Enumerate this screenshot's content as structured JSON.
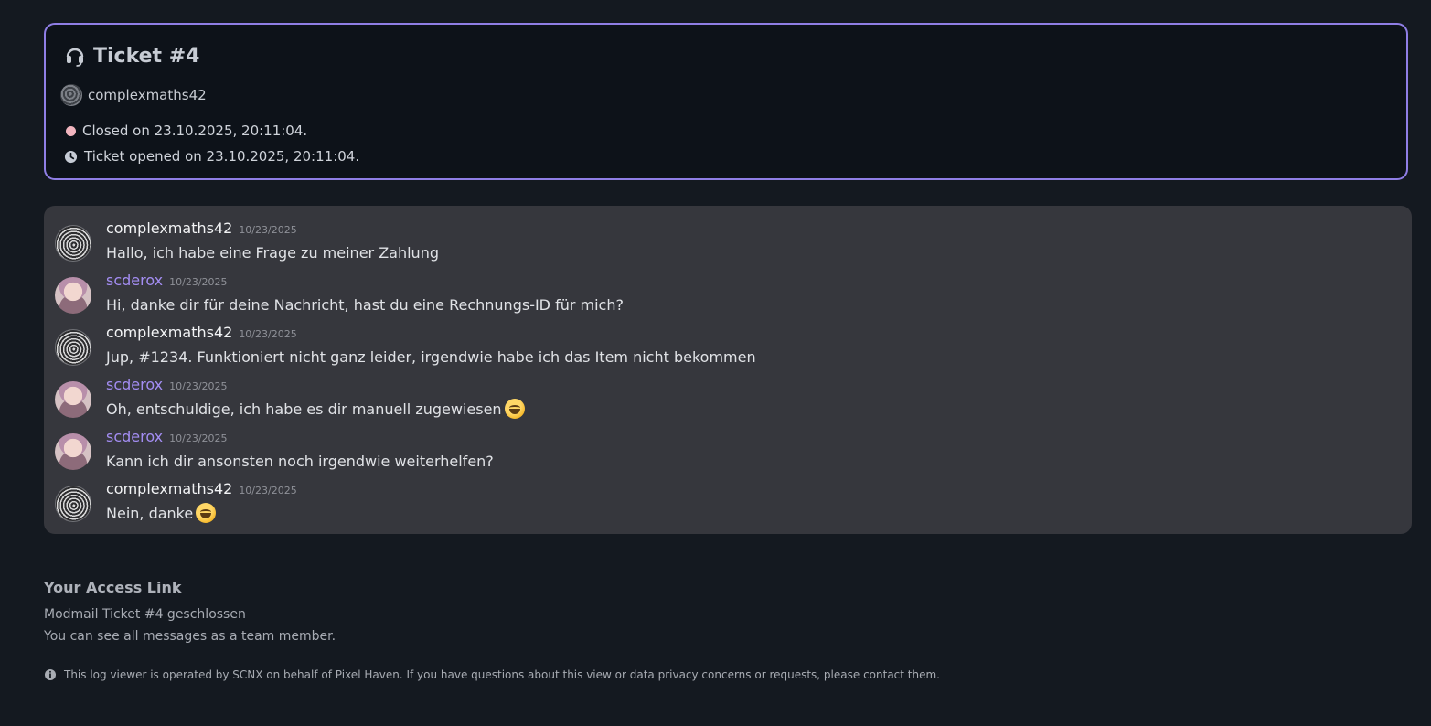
{
  "ticket": {
    "title": "Ticket #4",
    "user": "complexmaths42",
    "status": "Closed on 23.10.2025, 20:11:04.",
    "opened": "Ticket opened on 23.10.2025, 20:11:04.",
    "border_color": "#8f7ee5",
    "status_color": "#f1b5bf",
    "icons": {
      "title": "headset-icon",
      "opened": "clock-icon"
    }
  },
  "messages": [
    {
      "author": "complexmaths42",
      "time": "10/23/2025",
      "text": "Hallo, ich habe eine Frage zu meiner Zahlung",
      "role": "user"
    },
    {
      "author": "scderox",
      "time": "10/23/2025",
      "text": "Hi, danke dir für deine Nachricht, hast du eine Rechnungs-ID für mich?",
      "role": "staff"
    },
    {
      "author": "complexmaths42",
      "time": "10/23/2025",
      "text": "Jup, #1234. Funktioniert nicht ganz leider, irgendwie habe ich das Item nicht bekommen",
      "role": "user"
    },
    {
      "author": "scderox",
      "time": "10/23/2025",
      "text": "Oh, entschuldige, ich habe es dir manuell zugewiesen",
      "role": "staff",
      "emoji": "grinning-face-icon"
    },
    {
      "author": "scderox",
      "time": "10/23/2025",
      "text": "Kann ich dir ansonsten noch irgendwie weiterhelfen?",
      "role": "staff"
    },
    {
      "author": "complexmaths42",
      "time": "10/23/2025",
      "text": "Nein, danke",
      "role": "user",
      "emoji": "grinning-face-icon"
    }
  ],
  "access": {
    "title": "Your Access Link",
    "line1": "Modmail Ticket #4 geschlossen",
    "line2": "You can see all messages as a team member."
  },
  "footer": {
    "text": "This log viewer is operated by SCNX on behalf of Pixel Haven. If you have questions about this view or data privacy concerns or requests, please contact them.",
    "icon": "info-icon"
  },
  "colors": {
    "background": "#141920",
    "message_panel": "#36373d",
    "staff_name": "#a38df2"
  }
}
